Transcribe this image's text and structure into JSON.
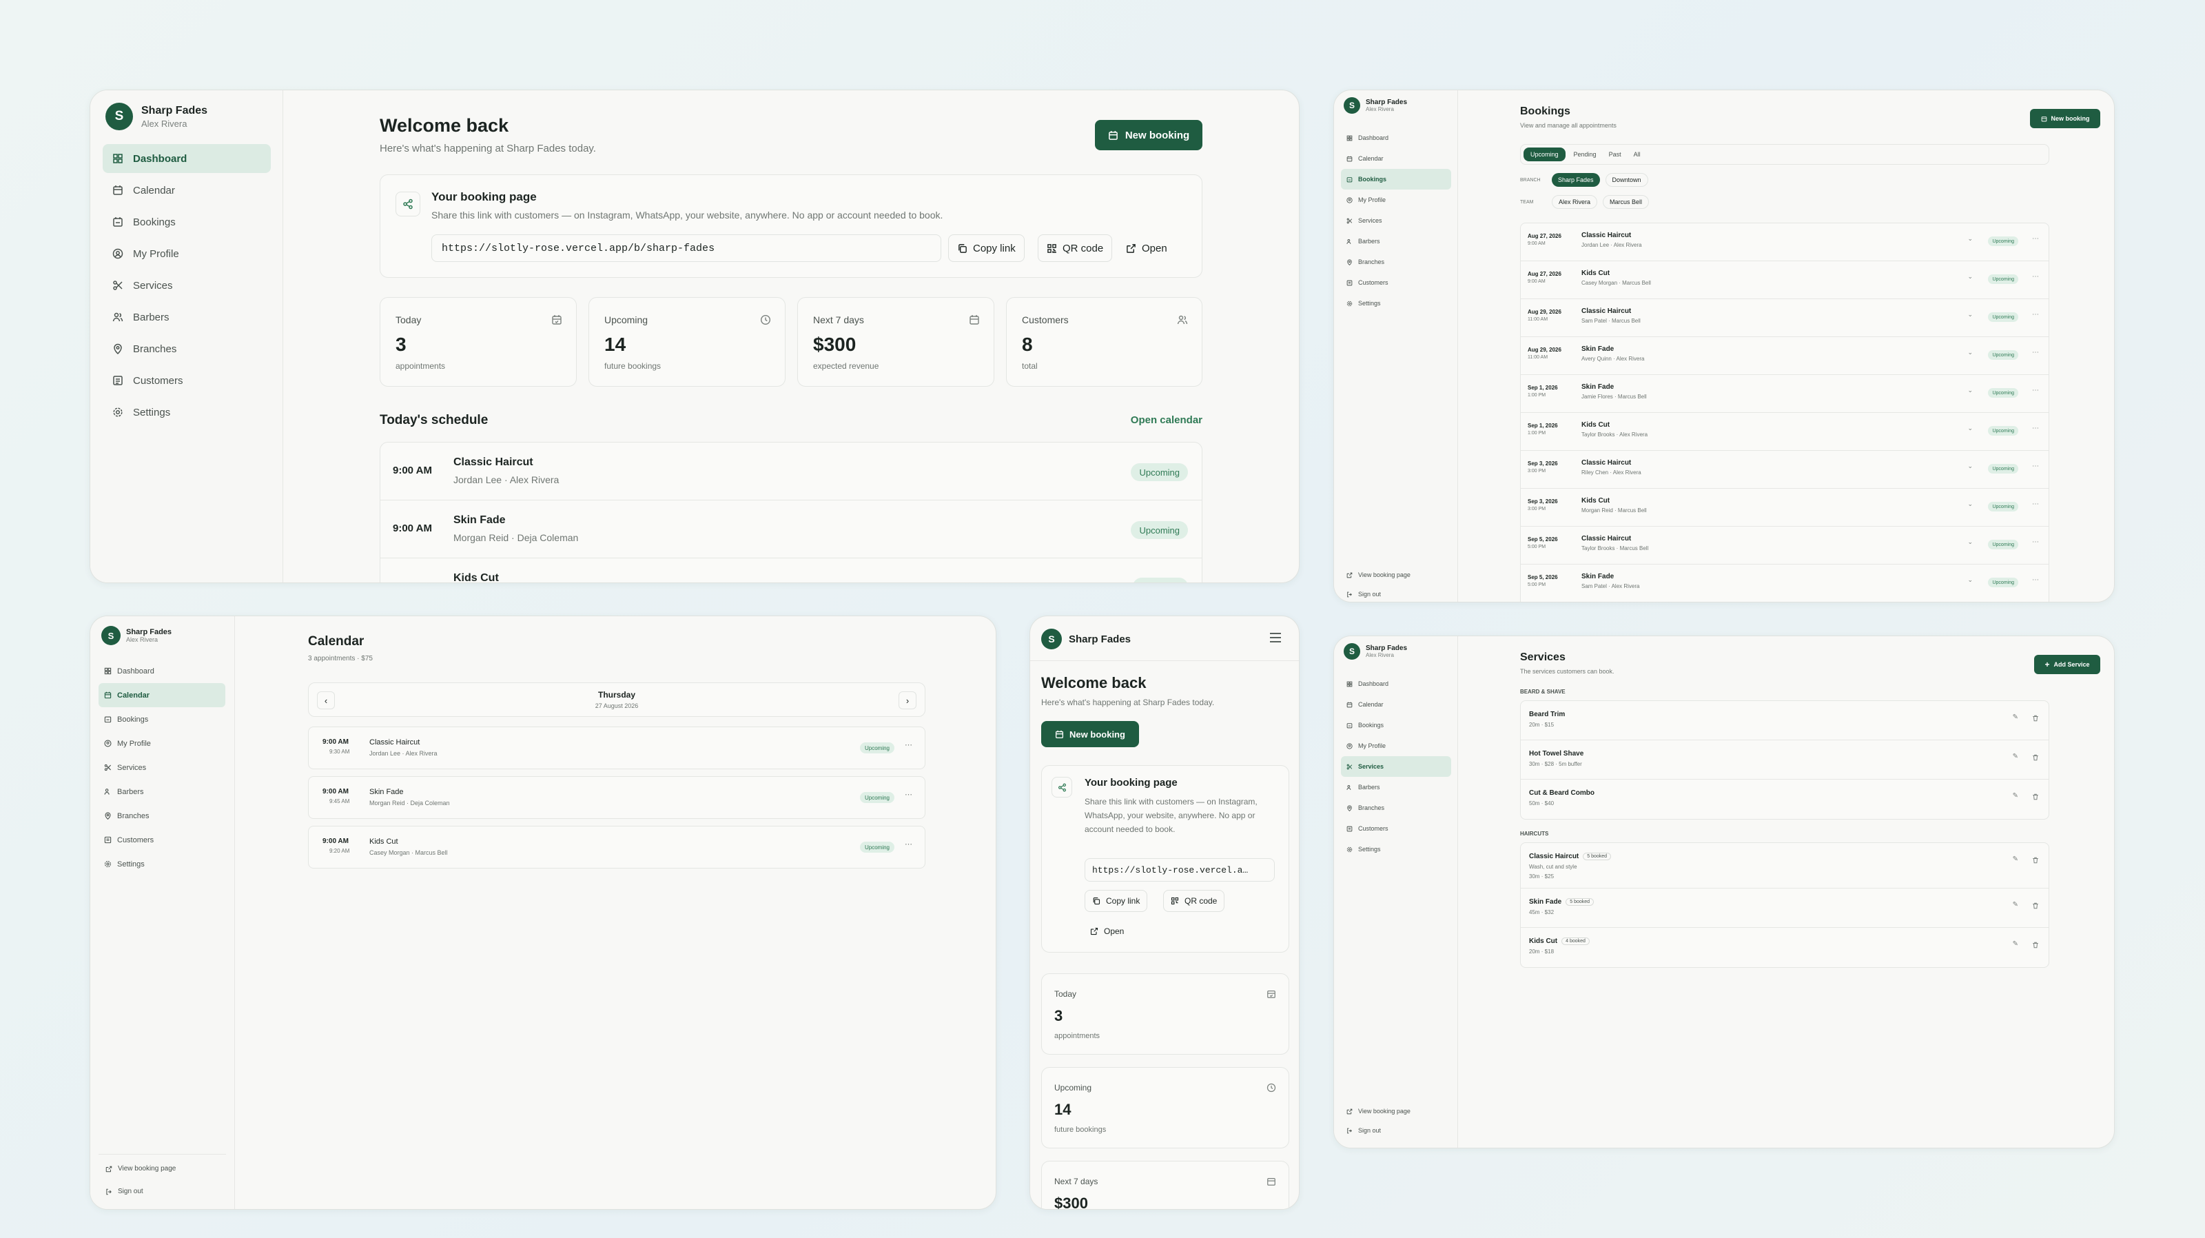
{
  "brand": {
    "name": "Sharp Fades",
    "user": "Alex Rivera",
    "initial": "S"
  },
  "nav": {
    "dashboard": "Dashboard",
    "calendar": "Calendar",
    "bookings": "Bookings",
    "profile": "My Profile",
    "services": "Services",
    "barbers": "Barbers",
    "branches": "Branches",
    "customers": "Customers",
    "settings": "Settings",
    "view_booking_page": "View booking page",
    "sign_out": "Sign out"
  },
  "dashboard": {
    "title": "Welcome back",
    "subtitle": "Here's what's happening at Sharp Fades today.",
    "new_booking": "New booking",
    "booking_page": {
      "title": "Your booking page",
      "desc": "Share this link with customers — on Instagram, WhatsApp, your website, anywhere. No app or account needed to book.",
      "url": "https://slotly-rose.vercel.app/b/sharp-fades",
      "url_short": "https://slotly-rose.vercel.a…",
      "copy": "Copy link",
      "qr": "QR code",
      "open": "Open"
    },
    "stats": [
      {
        "label": "Today",
        "value": "3",
        "note": "appointments"
      },
      {
        "label": "Upcoming",
        "value": "14",
        "note": "future bookings"
      },
      {
        "label": "Next 7 days",
        "value": "$300",
        "note": "expected revenue"
      },
      {
        "label": "Customers",
        "value": "8",
        "note": "total"
      }
    ],
    "schedule_title": "Today's schedule",
    "open_calendar": "Open calendar",
    "schedule": [
      {
        "time": "9:00 AM",
        "service": "Classic Haircut",
        "people": "Jordan Lee · Alex Rivera",
        "status": "Upcoming"
      },
      {
        "time": "9:00 AM",
        "service": "Skin Fade",
        "people": "Morgan Reid · Deja Coleman",
        "status": "Upcoming"
      },
      {
        "time": "",
        "service": "Kids Cut",
        "people": "",
        "status": ""
      }
    ]
  },
  "bookings": {
    "title": "Bookings",
    "subtitle": "View and manage all appointments",
    "new_booking": "New booking",
    "tabs": [
      "Upcoming",
      "Pending",
      "Past",
      "All"
    ],
    "branch_label": "BRANCH",
    "branches": [
      "Sharp Fades",
      "Downtown"
    ],
    "team_label": "TEAM",
    "team": [
      "Alex Rivera",
      "Marcus Bell"
    ],
    "rows": [
      {
        "date": "Aug 27, 2026",
        "time": "9:00 AM",
        "service": "Classic Haircut",
        "people": "Jordan Lee · Alex Rivera",
        "status": "Upcoming"
      },
      {
        "date": "Aug 27, 2026",
        "time": "9:00 AM",
        "service": "Kids Cut",
        "people": "Casey Morgan · Marcus Bell",
        "status": "Upcoming"
      },
      {
        "date": "Aug 29, 2026",
        "time": "11:00 AM",
        "service": "Classic Haircut",
        "people": "Sam Patel · Marcus Bell",
        "status": "Upcoming"
      },
      {
        "date": "Aug 29, 2026",
        "time": "11:00 AM",
        "service": "Skin Fade",
        "people": "Avery Quinn · Alex Rivera",
        "status": "Upcoming"
      },
      {
        "date": "Sep 1, 2026",
        "time": "1:00 PM",
        "service": "Skin Fade",
        "people": "Jamie Flores · Marcus Bell",
        "status": "Upcoming"
      },
      {
        "date": "Sep 1, 2026",
        "time": "1:00 PM",
        "service": "Kids Cut",
        "people": "Taylor Brooks · Alex Rivera",
        "status": "Upcoming"
      },
      {
        "date": "Sep 3, 2026",
        "time": "3:00 PM",
        "service": "Classic Haircut",
        "people": "Riley Chen · Alex Rivera",
        "status": "Upcoming"
      },
      {
        "date": "Sep 3, 2026",
        "time": "3:00 PM",
        "service": "Kids Cut",
        "people": "Morgan Reid · Marcus Bell",
        "status": "Upcoming"
      },
      {
        "date": "Sep 5, 2026",
        "time": "5:00 PM",
        "service": "Classic Haircut",
        "people": "Taylor Brooks · Marcus Bell",
        "status": "Upcoming"
      },
      {
        "date": "Sep 5, 2026",
        "time": "5:00 PM",
        "service": "Skin Fade",
        "people": "Sam Patel · Alex Rivera",
        "status": "Upcoming"
      }
    ]
  },
  "calendar": {
    "title": "Calendar",
    "subtitle": "3 appointments · $75",
    "day": "Thursday",
    "date": "27 August 2026",
    "rows": [
      {
        "start": "9:00 AM",
        "end": "9:30 AM",
        "service": "Classic Haircut",
        "people": "Jordan Lee · Alex Rivera",
        "status": "Upcoming"
      },
      {
        "start": "9:00 AM",
        "end": "9:45 AM",
        "service": "Skin Fade",
        "people": "Morgan Reid · Deja Coleman",
        "status": "Upcoming"
      },
      {
        "start": "9:00 AM",
        "end": "9:20 AM",
        "service": "Kids Cut",
        "people": "Casey Morgan · Marcus Bell",
        "status": "Upcoming"
      }
    ]
  },
  "services": {
    "title": "Services",
    "subtitle": "The services customers can book.",
    "add": "Add Service",
    "groups": [
      {
        "name": "BEARD & SHAVE",
        "items": [
          {
            "name": "Beard Trim",
            "desc": "",
            "meta": "20m · $15",
            "badge": ""
          },
          {
            "name": "Hot Towel Shave",
            "desc": "",
            "meta": "30m · $28 · 5m buffer",
            "badge": ""
          },
          {
            "name": "Cut & Beard Combo",
            "desc": "",
            "meta": "50m · $40",
            "badge": ""
          }
        ]
      },
      {
        "name": "HAIRCUTS",
        "items": [
          {
            "name": "Classic Haircut",
            "desc": "Wash, cut and style",
            "meta": "30m · $25",
            "badge": "5 booked"
          },
          {
            "name": "Skin Fade",
            "desc": "",
            "meta": "45m · $32",
            "badge": "5 booked"
          },
          {
            "name": "Kids Cut",
            "desc": "",
            "meta": "20m · $18",
            "badge": "4 booked"
          }
        ]
      }
    ]
  },
  "mobile": {
    "partial_value": "$300"
  },
  "colors": {
    "accent": "#1f5c41",
    "badge_bg": "#dfefe6",
    "badge_text": "#2f7a55",
    "background": "#eef5f4"
  }
}
